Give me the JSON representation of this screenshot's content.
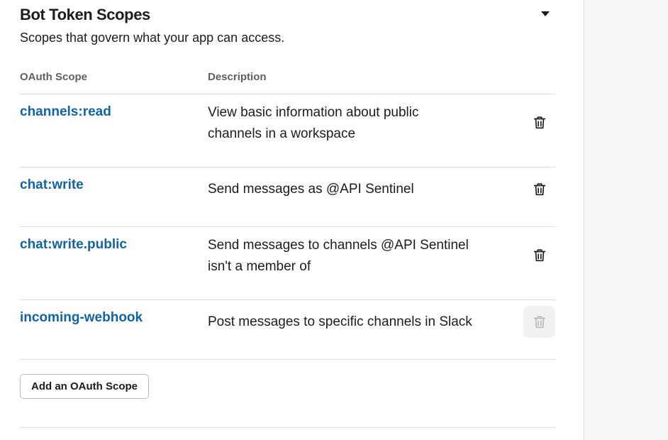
{
  "section": {
    "title": "Bot Token Scopes",
    "subtitle": "Scopes that govern what your app can access.",
    "collapse_icon": "caret-down-icon"
  },
  "table": {
    "columns": [
      "OAuth Scope",
      "Description"
    ],
    "rows": [
      {
        "scope": "channels:read",
        "description_lines": [
          "View basic information about public",
          "channels in a workspace"
        ],
        "remove_icon": "trash-icon",
        "remove_enabled": true
      },
      {
        "scope": "chat:write",
        "description_lines": [
          "Send messages as @API Sentinel"
        ],
        "remove_icon": "trash-icon",
        "remove_enabled": true
      },
      {
        "scope": "chat:write.public",
        "description_lines": [
          "Send messages to channels @API Sentinel",
          "isn't a member of"
        ],
        "remove_icon": "trash-icon",
        "remove_enabled": true
      },
      {
        "scope": "incoming-webhook",
        "description_lines": [
          "Post messages to specific channels in Slack"
        ],
        "remove_icon": "trash-icon",
        "remove_enabled": false
      }
    ]
  },
  "add_button": {
    "label": "Add an OAuth Scope"
  },
  "colors": {
    "link": "#1264a3",
    "text": "#1d1c1d",
    "muted": "#616061",
    "divider": "#dddddd"
  }
}
